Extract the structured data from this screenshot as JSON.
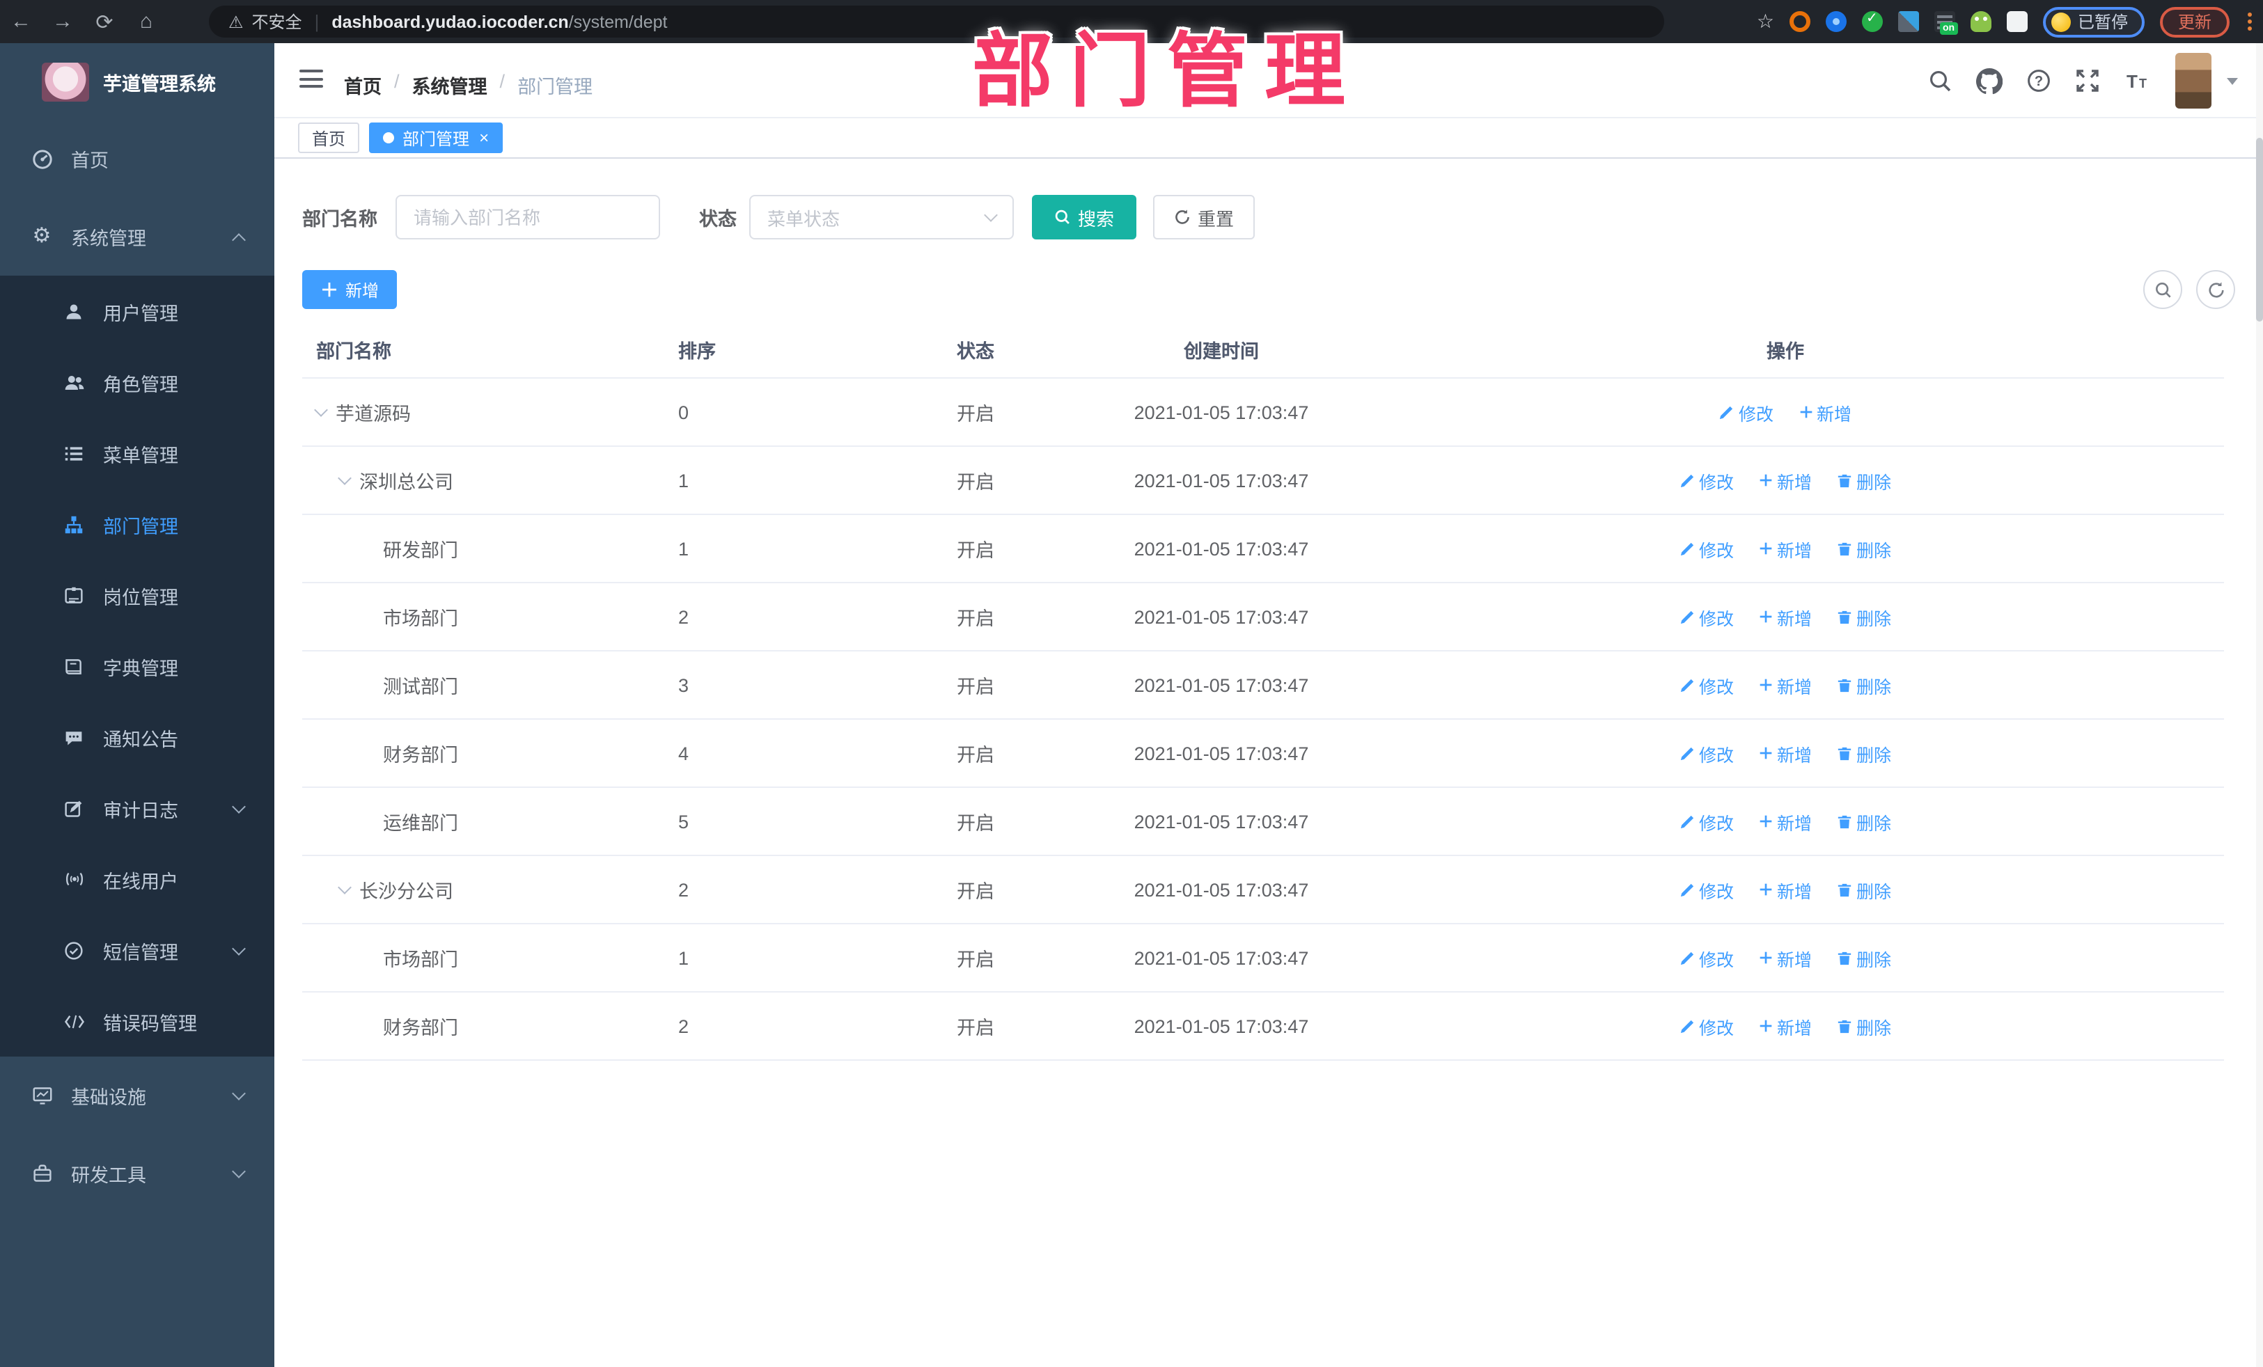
{
  "watermark": "部门管理",
  "browser": {
    "security_label": "不安全",
    "url_host": "dashboard.yudao.iocoder.cn",
    "url_path": "/system/dept",
    "extension_badge": "on",
    "paused_label": "已暂停",
    "update_label": "更新"
  },
  "sidebar": {
    "logo_title": "芋道管理系统",
    "items": [
      {
        "label": "首页"
      },
      {
        "label": "系统管理",
        "children": [
          {
            "label": "用户管理"
          },
          {
            "label": "角色管理"
          },
          {
            "label": "菜单管理"
          },
          {
            "label": "部门管理"
          },
          {
            "label": "岗位管理"
          },
          {
            "label": "字典管理"
          },
          {
            "label": "通知公告"
          },
          {
            "label": "审计日志"
          },
          {
            "label": "在线用户"
          },
          {
            "label": "短信管理"
          },
          {
            "label": "错误码管理"
          }
        ]
      },
      {
        "label": "基础设施"
      },
      {
        "label": "研发工具"
      }
    ]
  },
  "header": {
    "breadcrumb": [
      {
        "label": "首页"
      },
      {
        "label": "系统管理"
      },
      {
        "label": "部门管理"
      }
    ]
  },
  "tabs": [
    {
      "label": "首页"
    },
    {
      "label": "部门管理"
    }
  ],
  "filters": {
    "dept_label": "部门名称",
    "dept_placeholder": "请输入部门名称",
    "status_label": "状态",
    "status_placeholder": "菜单状态",
    "search_label": "搜索",
    "reset_label": "重置"
  },
  "toolbar": {
    "add_label": "新增"
  },
  "table": {
    "columns": [
      "部门名称",
      "排序",
      "状态",
      "创建时间",
      "操作"
    ],
    "actions": {
      "edit": "修改",
      "add": "新增",
      "delete": "删除"
    },
    "rows": [
      {
        "name": "芋道源码",
        "sort": "0",
        "status": "开启",
        "created": "2021-01-05 17:03:47"
      },
      {
        "name": "深圳总公司",
        "sort": "1",
        "status": "开启",
        "created": "2021-01-05 17:03:47"
      },
      {
        "name": "研发部门",
        "sort": "1",
        "status": "开启",
        "created": "2021-01-05 17:03:47"
      },
      {
        "name": "市场部门",
        "sort": "2",
        "status": "开启",
        "created": "2021-01-05 17:03:47"
      },
      {
        "name": "测试部门",
        "sort": "3",
        "status": "开启",
        "created": "2021-01-05 17:03:47"
      },
      {
        "name": "财务部门",
        "sort": "4",
        "status": "开启",
        "created": "2021-01-05 17:03:47"
      },
      {
        "name": "运维部门",
        "sort": "5",
        "status": "开启",
        "created": "2021-01-05 17:03:47"
      },
      {
        "name": "长沙分公司",
        "sort": "2",
        "status": "开启",
        "created": "2021-01-05 17:03:47"
      },
      {
        "name": "市场部门",
        "sort": "1",
        "status": "开启",
        "created": "2021-01-05 17:03:47"
      },
      {
        "name": "财务部门",
        "sort": "2",
        "status": "开启",
        "created": "2021-01-05 17:03:47"
      }
    ]
  },
  "colors": {
    "accent_blue": "#409eff",
    "search_teal": "#17b3a3",
    "watermark_pink": "#f43a68",
    "sidebar_bg": "#32485c",
    "submenu_bg": "#1f2d3d"
  }
}
